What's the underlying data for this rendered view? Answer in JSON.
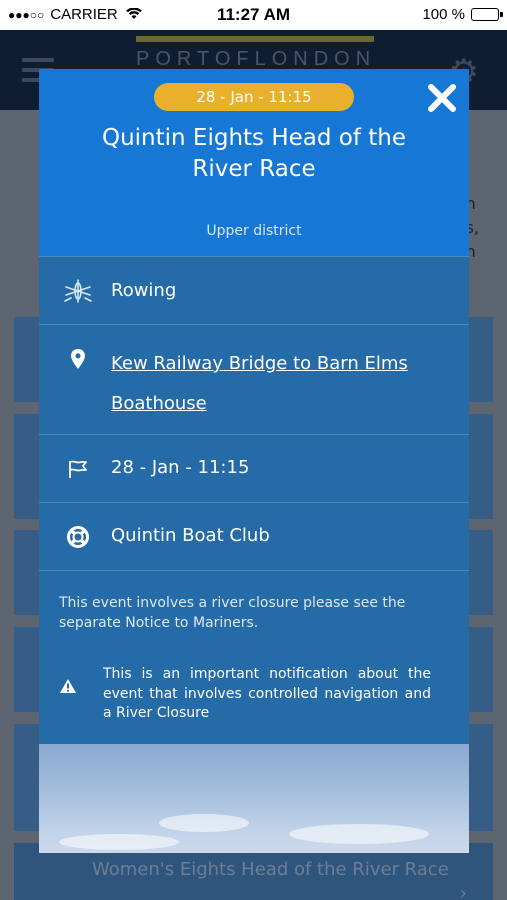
{
  "status_bar": {
    "signal_dots": "●●●○○",
    "carrier": "CARRIER",
    "time": "11:27 AM",
    "battery": "100 %",
    "battery_level": 1.0
  },
  "app": {
    "logo_text": "PORTOFLONDON",
    "background_text": [
      "n",
      "s,",
      "n"
    ],
    "background_card_title": "Women's Eights Head of the River Race"
  },
  "modal": {
    "date_badge": "28 - Jan - 11:15",
    "title": "Quintin Eights Head of the River Race",
    "district": "Upper district",
    "rows": {
      "activity": "Rowing",
      "location": "Kew Railway Bridge to Barn Elms Boathouse",
      "start": "28 - Jan - 11:15",
      "organiser": "Quintin Boat Club"
    },
    "notice": "This event involves a river closure please see the separate Notice to Mariners.",
    "warning": "This is an important notification about the event that involves controlled navigation and a River Closure"
  },
  "colors": {
    "header_blue": "#1777d4",
    "modal_blue": "#256ba8",
    "badge_gold": "#e9b02b",
    "app_header": "#0f1d33"
  },
  "icons": [
    "rowing-icon",
    "location-pin-icon",
    "flag-icon",
    "lifebuoy-icon",
    "warning-icon",
    "close-icon",
    "hamburger-icon",
    "gear-icon"
  ]
}
